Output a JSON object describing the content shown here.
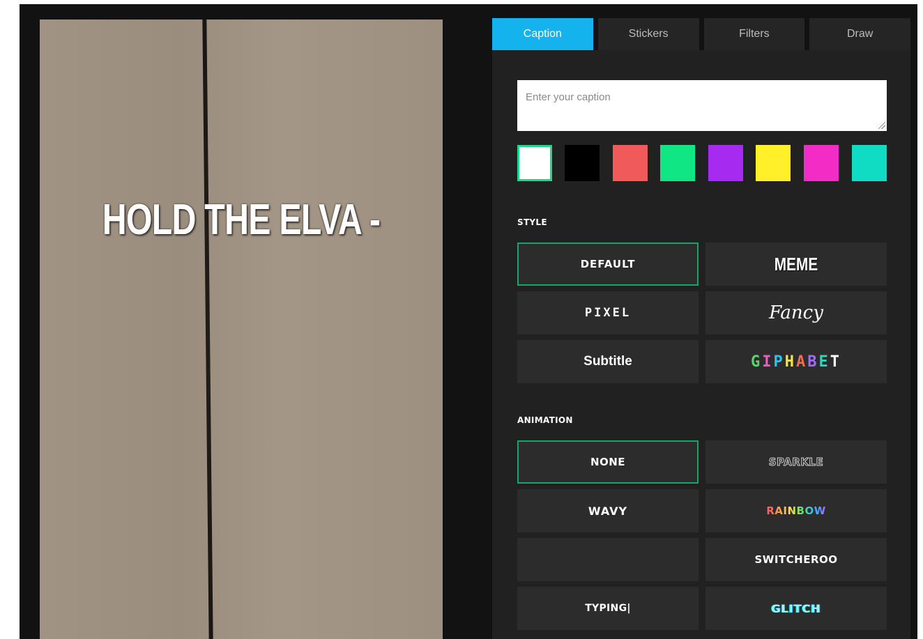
{
  "preview": {
    "caption": "HOLD THE ELVA -"
  },
  "tabs": [
    {
      "label": "Caption",
      "active": true
    },
    {
      "label": "Stickers",
      "active": false
    },
    {
      "label": "Filters",
      "active": false
    },
    {
      "label": "Draw",
      "active": false
    }
  ],
  "caption_input": {
    "placeholder": "Enter your caption",
    "value": ""
  },
  "colors": {
    "accent": "#15b3ee",
    "selected_border": "#13a66d",
    "swatches": [
      "#ffffff",
      "#000000",
      "#f05a5a",
      "#10e684",
      "#a62af0",
      "#fff02a",
      "#f22cc4",
      "#10dcc4"
    ],
    "selected_swatch": "#ffffff"
  },
  "style": {
    "label": "STYLE",
    "options": [
      {
        "label": "DEFAULT",
        "selected": true
      },
      {
        "label": "MEME",
        "selected": false
      },
      {
        "label": "PIXEL",
        "selected": false
      },
      {
        "label": "Fancy",
        "selected": false
      },
      {
        "label": "Subtitle",
        "selected": false
      },
      {
        "label": "GIPHABET",
        "selected": false
      }
    ]
  },
  "animation": {
    "label": "ANIMATION",
    "options": [
      {
        "label": "NONE",
        "selected": true
      },
      {
        "label": "SPARKLE",
        "selected": false
      },
      {
        "label": "WAVY",
        "selected": false
      },
      {
        "label": "RAINBOW",
        "selected": false
      },
      {
        "label": "",
        "selected": false
      },
      {
        "label": "SWITCHEROO",
        "selected": false
      },
      {
        "label": "TYPING|",
        "selected": false
      },
      {
        "label": "GLITCH",
        "selected": false
      }
    ]
  }
}
